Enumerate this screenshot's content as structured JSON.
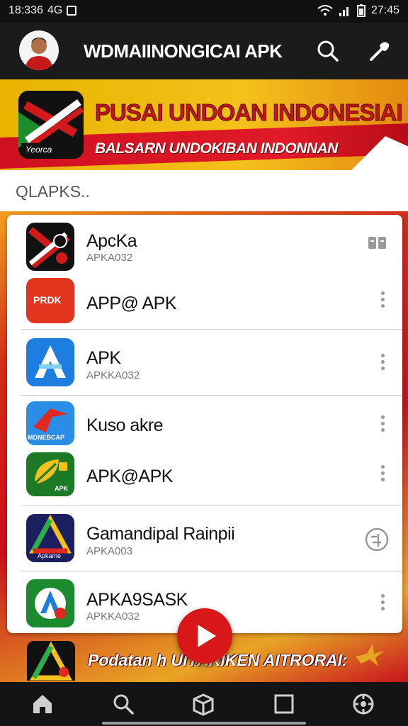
{
  "status_bar": {
    "time": "18:336",
    "network": "4G",
    "clock": "27:45"
  },
  "app_bar": {
    "title": "WDMAIINONGICAI APK",
    "icons": [
      "avatar",
      "search-icon",
      "tools-icon"
    ]
  },
  "banner": {
    "logo_text": "Yeorca",
    "title": "PUSAI UNDOAN INDONESIAI",
    "subtitle": "BALSARN UNDOKIBAN INDONNAN"
  },
  "search": {
    "placeholder": "QLAPKS.."
  },
  "apps": [
    {
      "name": "ApcKa",
      "sub": "APKA032",
      "icon": "x-flag-icon",
      "action": "book-icon",
      "icon_color": "#111111"
    },
    {
      "name": "APP@ APK",
      "sub": "",
      "icon_label": "PRDK",
      "icon": "prdk-icon",
      "action": "more-icon",
      "icon_color": "#e3341e"
    },
    {
      "name": "APK",
      "sub": "APKKA032",
      "icon": "a-store-icon",
      "action": "more-icon",
      "icon_color": "#1e7ee0"
    },
    {
      "name": "Kuso akre",
      "sub": "",
      "icon_label": "MDNEBCAP",
      "icon": "red-arrow-icon",
      "action": "more-icon",
      "icon_color": "#2a8ee6"
    },
    {
      "name": "APK@APK",
      "sub": "",
      "icon_label": "APK",
      "icon": "leaf-icon",
      "action": "more-icon",
      "icon_color": "#1c7a26"
    },
    {
      "name": "Gamandipal Rainpii",
      "sub": "APKA003",
      "icon_label": "Apkame",
      "icon": "triangle-a-icon",
      "action": "globe-icon",
      "icon_color": "#1b1f5e"
    },
    {
      "name": "APKA9SASK",
      "sub": "APKKA032",
      "icon": "green-a-icon",
      "action": "more-icon",
      "icon_color": "#1c8a2e"
    }
  ],
  "promo": {
    "text": "Podatan h UIYARIKEN AITRORAI:"
  },
  "nav": [
    "home-icon",
    "search-icon",
    "box-icon",
    "square-icon",
    "compass-icon"
  ],
  "colors": {
    "brand_red": "#c8101e",
    "brand_yellow": "#f4c01b",
    "dark_bar": "#1b1b1b"
  }
}
